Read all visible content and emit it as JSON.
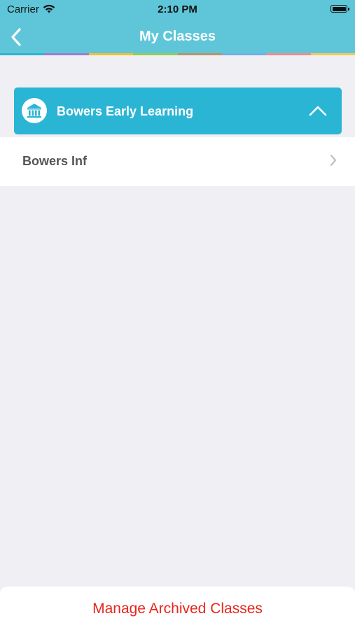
{
  "status_bar": {
    "carrier": "Carrier",
    "time": "2:10 PM"
  },
  "nav": {
    "title": "My Classes",
    "back_icon": "chevron-left-icon"
  },
  "color_strip": [
    "#2bb5d4",
    "#9a7fcf",
    "#f2c12e",
    "#8ccf5a",
    "#b7956b",
    "#6fb0e8",
    "#f08b8b",
    "#f5c85a"
  ],
  "school": {
    "name": "Bowers Early Learning",
    "icon": "institution-icon",
    "expanded": true,
    "toggle_icon": "chevron-up-icon"
  },
  "classes": [
    {
      "name": "Bowers Inf"
    }
  ],
  "footer": {
    "manage_label": "Manage Archived Classes"
  },
  "colors": {
    "nav_background": "#5fc6d9",
    "header_background": "#2bb5d4",
    "manage_text": "#e8251c",
    "page_background": "#f0eff4"
  }
}
